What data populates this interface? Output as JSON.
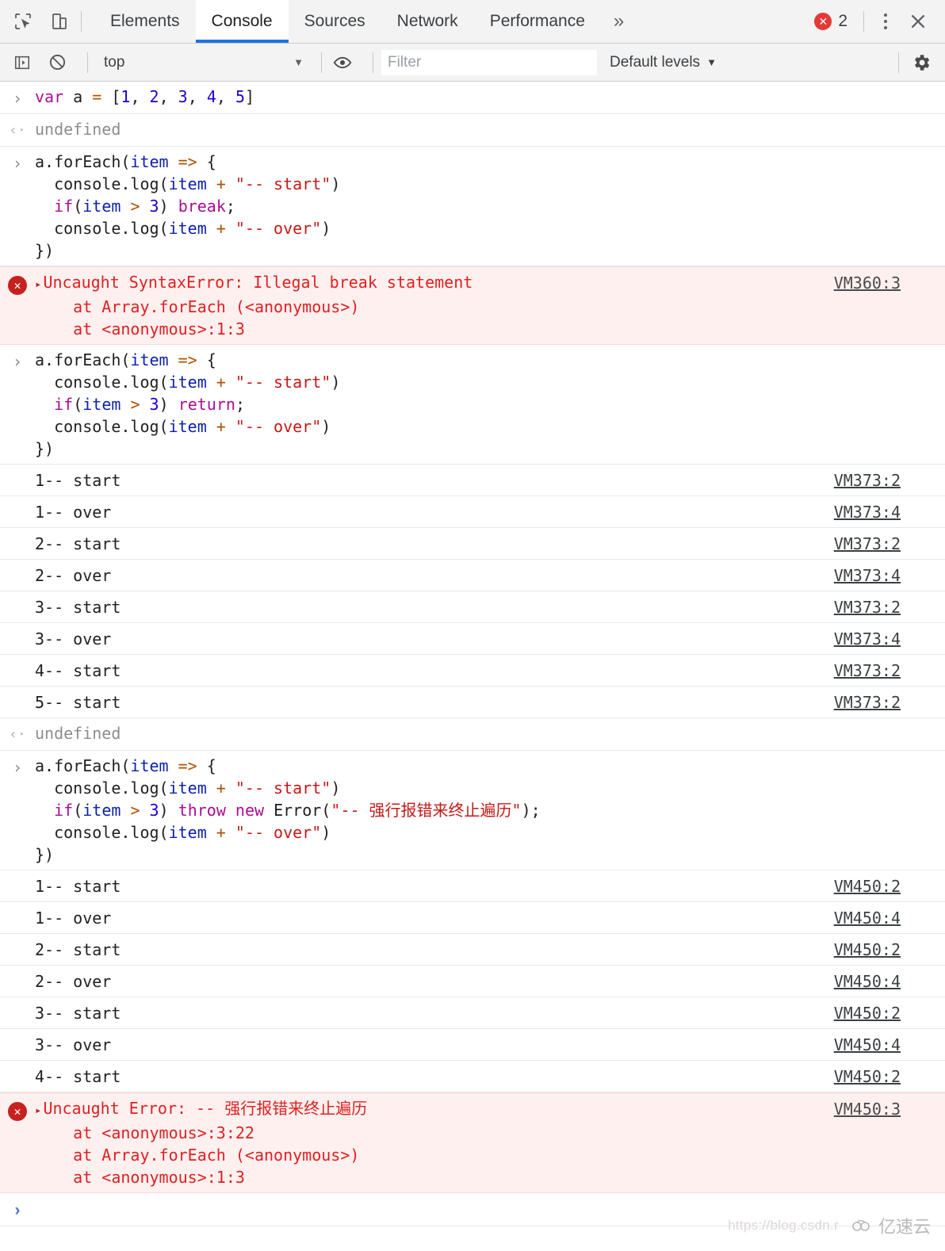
{
  "tabbar": {
    "icons": [
      {
        "name": "inspect-element-icon",
        "title": "Inspect"
      },
      {
        "name": "device-toolbar-icon",
        "title": "Toggle device toolbar"
      }
    ],
    "tabs": [
      {
        "label": "Elements",
        "active": false
      },
      {
        "label": "Console",
        "active": true
      },
      {
        "label": "Sources",
        "active": false
      },
      {
        "label": "Network",
        "active": false
      },
      {
        "label": "Performance",
        "active": false
      }
    ],
    "more_label": "»",
    "error_count": "2",
    "error_glyph": "✕",
    "close_glyph": "✕",
    "accent_color": "#1a73e8",
    "error_color": "#e53935"
  },
  "console_toolbar": {
    "sidebar_toggle": "console-sidebar-icon",
    "clear_console": "clear-console-icon",
    "context": "top",
    "context_caret": "▼",
    "eye_icon": "live-expression-icon",
    "filter_placeholder": "Filter",
    "filter_value": "",
    "levels_label": "Default levels",
    "levels_caret": "▼",
    "settings_icon": "gear-icon"
  },
  "console_entries": [
    {
      "kind": "input",
      "gutter": "›",
      "tokens": [
        {
          "t": "kw",
          "v": "var"
        },
        {
          "t": "plain",
          "v": " a "
        },
        {
          "t": "op",
          "v": "="
        },
        {
          "t": "plain",
          "v": " ["
        },
        {
          "t": "num",
          "v": "1"
        },
        {
          "t": "plain",
          "v": ", "
        },
        {
          "t": "num",
          "v": "2"
        },
        {
          "t": "plain",
          "v": ", "
        },
        {
          "t": "num",
          "v": "3"
        },
        {
          "t": "plain",
          "v": ", "
        },
        {
          "t": "num",
          "v": "4"
        },
        {
          "t": "plain",
          "v": ", "
        },
        {
          "t": "num",
          "v": "5"
        },
        {
          "t": "plain",
          "v": "]"
        }
      ]
    },
    {
      "kind": "result",
      "gutter": "‹·",
      "text": "undefined"
    },
    {
      "kind": "input",
      "gutter": "›",
      "tokens": [
        {
          "t": "plain",
          "v": "a.forEach("
        },
        {
          "t": "ident",
          "v": "item"
        },
        {
          "t": "plain",
          "v": " "
        },
        {
          "t": "op",
          "v": "=>"
        },
        {
          "t": "plain",
          "v": " {\n  console.log("
        },
        {
          "t": "ident",
          "v": "item"
        },
        {
          "t": "plain",
          "v": " "
        },
        {
          "t": "op",
          "v": "+"
        },
        {
          "t": "plain",
          "v": " "
        },
        {
          "t": "str",
          "v": "\"-- start\""
        },
        {
          "t": "plain",
          "v": ")\n  "
        },
        {
          "t": "kw",
          "v": "if"
        },
        {
          "t": "plain",
          "v": "("
        },
        {
          "t": "ident",
          "v": "item"
        },
        {
          "t": "plain",
          "v": " "
        },
        {
          "t": "op",
          "v": ">"
        },
        {
          "t": "plain",
          "v": " "
        },
        {
          "t": "num",
          "v": "3"
        },
        {
          "t": "plain",
          "v": ") "
        },
        {
          "t": "kw",
          "v": "break"
        },
        {
          "t": "plain",
          "v": ";\n  console.log("
        },
        {
          "t": "ident",
          "v": "item"
        },
        {
          "t": "plain",
          "v": " "
        },
        {
          "t": "op",
          "v": "+"
        },
        {
          "t": "plain",
          "v": " "
        },
        {
          "t": "str",
          "v": "\"-- over\""
        },
        {
          "t": "plain",
          "v": ")\n})"
        }
      ]
    },
    {
      "kind": "error",
      "disclosure": "▸",
      "title": "Uncaught SyntaxError: Illegal break statement",
      "stack": [
        "    at Array.forEach (<anonymous>)",
        "    at <anonymous>:1:3"
      ],
      "vm": "VM360:3"
    },
    {
      "kind": "input",
      "gutter": "›",
      "tokens": [
        {
          "t": "plain",
          "v": "a.forEach("
        },
        {
          "t": "ident",
          "v": "item"
        },
        {
          "t": "plain",
          "v": " "
        },
        {
          "t": "op",
          "v": "=>"
        },
        {
          "t": "plain",
          "v": " {\n  console.log("
        },
        {
          "t": "ident",
          "v": "item"
        },
        {
          "t": "plain",
          "v": " "
        },
        {
          "t": "op",
          "v": "+"
        },
        {
          "t": "plain",
          "v": " "
        },
        {
          "t": "str",
          "v": "\"-- start\""
        },
        {
          "t": "plain",
          "v": ")\n  "
        },
        {
          "t": "kw",
          "v": "if"
        },
        {
          "t": "plain",
          "v": "("
        },
        {
          "t": "ident",
          "v": "item"
        },
        {
          "t": "plain",
          "v": " "
        },
        {
          "t": "op",
          "v": ">"
        },
        {
          "t": "plain",
          "v": " "
        },
        {
          "t": "num",
          "v": "3"
        },
        {
          "t": "plain",
          "v": ") "
        },
        {
          "t": "kw",
          "v": "return"
        },
        {
          "t": "plain",
          "v": ";\n  console.log("
        },
        {
          "t": "ident",
          "v": "item"
        },
        {
          "t": "plain",
          "v": " "
        },
        {
          "t": "op",
          "v": "+"
        },
        {
          "t": "plain",
          "v": " "
        },
        {
          "t": "str",
          "v": "\"-- over\""
        },
        {
          "t": "plain",
          "v": ")\n})"
        }
      ]
    },
    {
      "kind": "log",
      "text": "1-- start",
      "vm": "VM373:2"
    },
    {
      "kind": "log",
      "text": "1-- over",
      "vm": "VM373:4"
    },
    {
      "kind": "log",
      "text": "2-- start",
      "vm": "VM373:2"
    },
    {
      "kind": "log",
      "text": "2-- over",
      "vm": "VM373:4"
    },
    {
      "kind": "log",
      "text": "3-- start",
      "vm": "VM373:2"
    },
    {
      "kind": "log",
      "text": "3-- over",
      "vm": "VM373:4"
    },
    {
      "kind": "log",
      "text": "4-- start",
      "vm": "VM373:2"
    },
    {
      "kind": "log",
      "text": "5-- start",
      "vm": "VM373:2"
    },
    {
      "kind": "result",
      "gutter": "‹·",
      "text": "undefined"
    },
    {
      "kind": "input",
      "gutter": "›",
      "tokens": [
        {
          "t": "plain",
          "v": "a.forEach("
        },
        {
          "t": "ident",
          "v": "item"
        },
        {
          "t": "plain",
          "v": " "
        },
        {
          "t": "op",
          "v": "=>"
        },
        {
          "t": "plain",
          "v": " {\n  console.log("
        },
        {
          "t": "ident",
          "v": "item"
        },
        {
          "t": "plain",
          "v": " "
        },
        {
          "t": "op",
          "v": "+"
        },
        {
          "t": "plain",
          "v": " "
        },
        {
          "t": "str",
          "v": "\"-- start\""
        },
        {
          "t": "plain",
          "v": ")\n  "
        },
        {
          "t": "kw",
          "v": "if"
        },
        {
          "t": "plain",
          "v": "("
        },
        {
          "t": "ident",
          "v": "item"
        },
        {
          "t": "plain",
          "v": " "
        },
        {
          "t": "op",
          "v": ">"
        },
        {
          "t": "plain",
          "v": " "
        },
        {
          "t": "num",
          "v": "3"
        },
        {
          "t": "plain",
          "v": ") "
        },
        {
          "t": "kw",
          "v": "throw new"
        },
        {
          "t": "plain",
          "v": " Error("
        },
        {
          "t": "str",
          "v": "\"-- 强行报错来终止遍历\""
        },
        {
          "t": "plain",
          "v": ");\n  console.log("
        },
        {
          "t": "ident",
          "v": "item"
        },
        {
          "t": "plain",
          "v": " "
        },
        {
          "t": "op",
          "v": "+"
        },
        {
          "t": "plain",
          "v": " "
        },
        {
          "t": "str",
          "v": "\"-- over\""
        },
        {
          "t": "plain",
          "v": ")\n})"
        }
      ]
    },
    {
      "kind": "log",
      "text": "1-- start",
      "vm": "VM450:2"
    },
    {
      "kind": "log",
      "text": "1-- over",
      "vm": "VM450:4"
    },
    {
      "kind": "log",
      "text": "2-- start",
      "vm": "VM450:2"
    },
    {
      "kind": "log",
      "text": "2-- over",
      "vm": "VM450:4"
    },
    {
      "kind": "log",
      "text": "3-- start",
      "vm": "VM450:2"
    },
    {
      "kind": "log",
      "text": "3-- over",
      "vm": "VM450:4"
    },
    {
      "kind": "log",
      "text": "4-- start",
      "vm": "VM450:2"
    },
    {
      "kind": "error",
      "disclosure": "▸",
      "title": "Uncaught Error: -- 强行报错来终止遍历",
      "stack": [
        "    at <anonymous>:3:22",
        "    at Array.forEach (<anonymous>)",
        "    at <anonymous>:1:3"
      ],
      "vm": "VM450:3"
    }
  ],
  "prompt": {
    "glyph": "›"
  },
  "watermark": {
    "url": "https://blog.csdn.r",
    "brand": "亿速云"
  }
}
